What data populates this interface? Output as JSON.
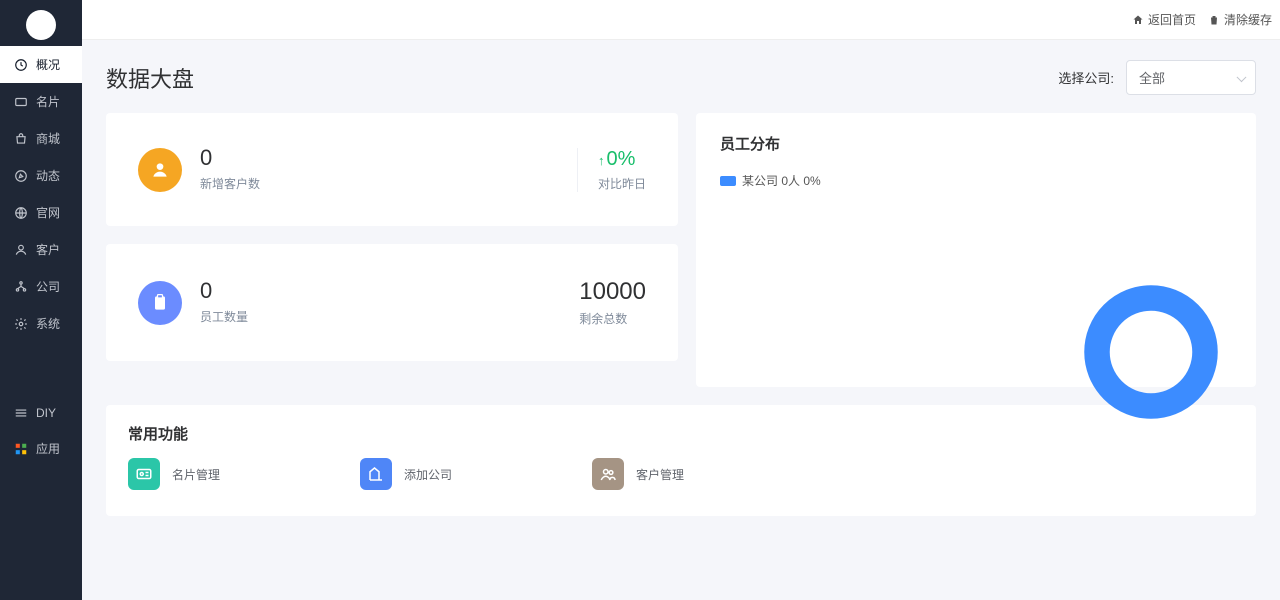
{
  "sidebar": {
    "items": [
      {
        "label": "概况"
      },
      {
        "label": "名片"
      },
      {
        "label": "商城"
      },
      {
        "label": "动态"
      },
      {
        "label": "官网"
      },
      {
        "label": "客户"
      },
      {
        "label": "公司"
      },
      {
        "label": "系统"
      }
    ],
    "extra": [
      {
        "label": "DIY"
      },
      {
        "label": "应用"
      }
    ]
  },
  "topbar": {
    "back": "返回首页",
    "clear": "清除缓存"
  },
  "page": {
    "title": "数据大盘",
    "companyLabel": "选择公司:",
    "companyValue": "全部"
  },
  "stats": {
    "newCustomers": {
      "value": "0",
      "label": "新增客户数",
      "pct": "0%",
      "pctLabel": "对比昨日"
    },
    "employees": {
      "value": "0",
      "label": "员工数量",
      "remain": "10000",
      "remainLabel": "剩余总数"
    }
  },
  "distribution": {
    "title": "员工分布",
    "legend": "某公司  0人  0%"
  },
  "funcs": {
    "title": "常用功能",
    "a": "名片管理",
    "b": "添加公司",
    "c": "客户管理"
  },
  "chart_data": {
    "type": "pie",
    "title": "员工分布",
    "series": [
      {
        "name": "某公司",
        "value": 0,
        "percent": 0
      }
    ],
    "total_people": 0
  }
}
